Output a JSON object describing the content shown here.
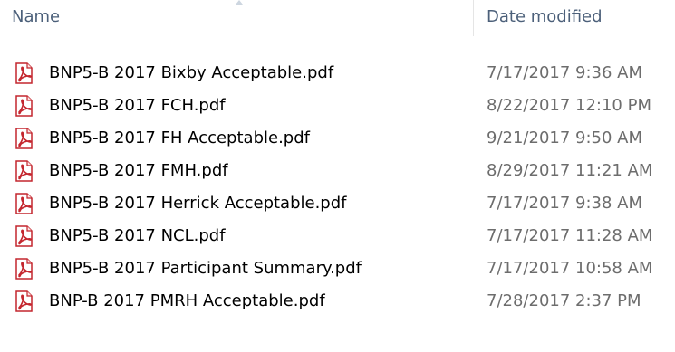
{
  "columns": {
    "name": "Name",
    "date_modified": "Date modified"
  },
  "icons": {
    "file": "pdf-file-icon",
    "sort": "sort-ascending-arrow"
  },
  "colors": {
    "header_text": "#4c607a",
    "date_text": "#6d6d6d",
    "pdf_red": "#c4262e"
  },
  "files": [
    {
      "name": "BNP5-B 2017 Bixby Acceptable.pdf",
      "date": "7/17/2017 9:36 AM"
    },
    {
      "name": "BNP5-B 2017 FCH.pdf",
      "date": "8/22/2017 12:10 PM"
    },
    {
      "name": "BNP5-B 2017 FH Acceptable.pdf",
      "date": "9/21/2017 9:50 AM"
    },
    {
      "name": "BNP5-B 2017 FMH.pdf",
      "date": "8/29/2017 11:21 AM"
    },
    {
      "name": "BNP5-B 2017 Herrick Acceptable.pdf",
      "date": "7/17/2017 9:38 AM"
    },
    {
      "name": "BNP5-B 2017 NCL.pdf",
      "date": "7/17/2017 11:28 AM"
    },
    {
      "name": "BNP5-B 2017 Participant Summary.pdf",
      "date": "7/17/2017 10:58 AM"
    },
    {
      "name": "BNP-B 2017 PMRH Acceptable.pdf",
      "date": "7/28/2017 2:37 PM"
    }
  ]
}
